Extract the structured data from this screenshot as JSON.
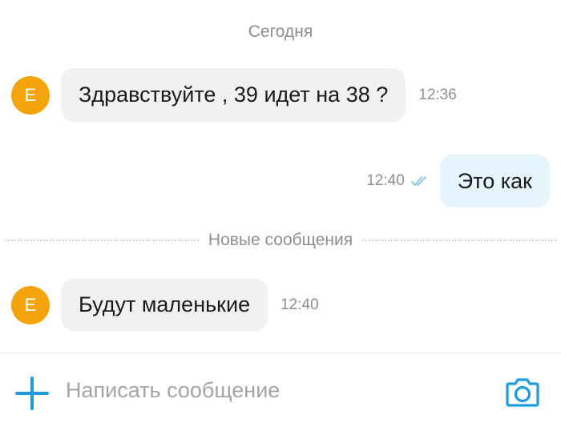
{
  "date_separator": "Сегодня",
  "messages": [
    {
      "direction": "incoming",
      "avatar_letter": "Е",
      "text": "Здравствуйте , 39 идет на 38 ?",
      "time": "12:36"
    },
    {
      "direction": "outgoing",
      "text": "Это как",
      "time": "12:40",
      "status_icon": "double-check-icon"
    },
    {
      "direction": "incoming",
      "avatar_letter": "Е",
      "text": "Будут маленькие",
      "time": "12:40"
    }
  ],
  "new_messages_separator": "Новые сообщения",
  "composer": {
    "placeholder": "Написать сообщение",
    "value": "",
    "attach_icon": "plus-icon",
    "camera_icon": "camera-icon"
  },
  "colors": {
    "avatar": "#f4a30a",
    "incoming_bubble": "#f1f1f3",
    "outgoing_bubble": "#e6f4fd",
    "accent": "#1e9be0",
    "secondary_text": "#8e8e93"
  }
}
